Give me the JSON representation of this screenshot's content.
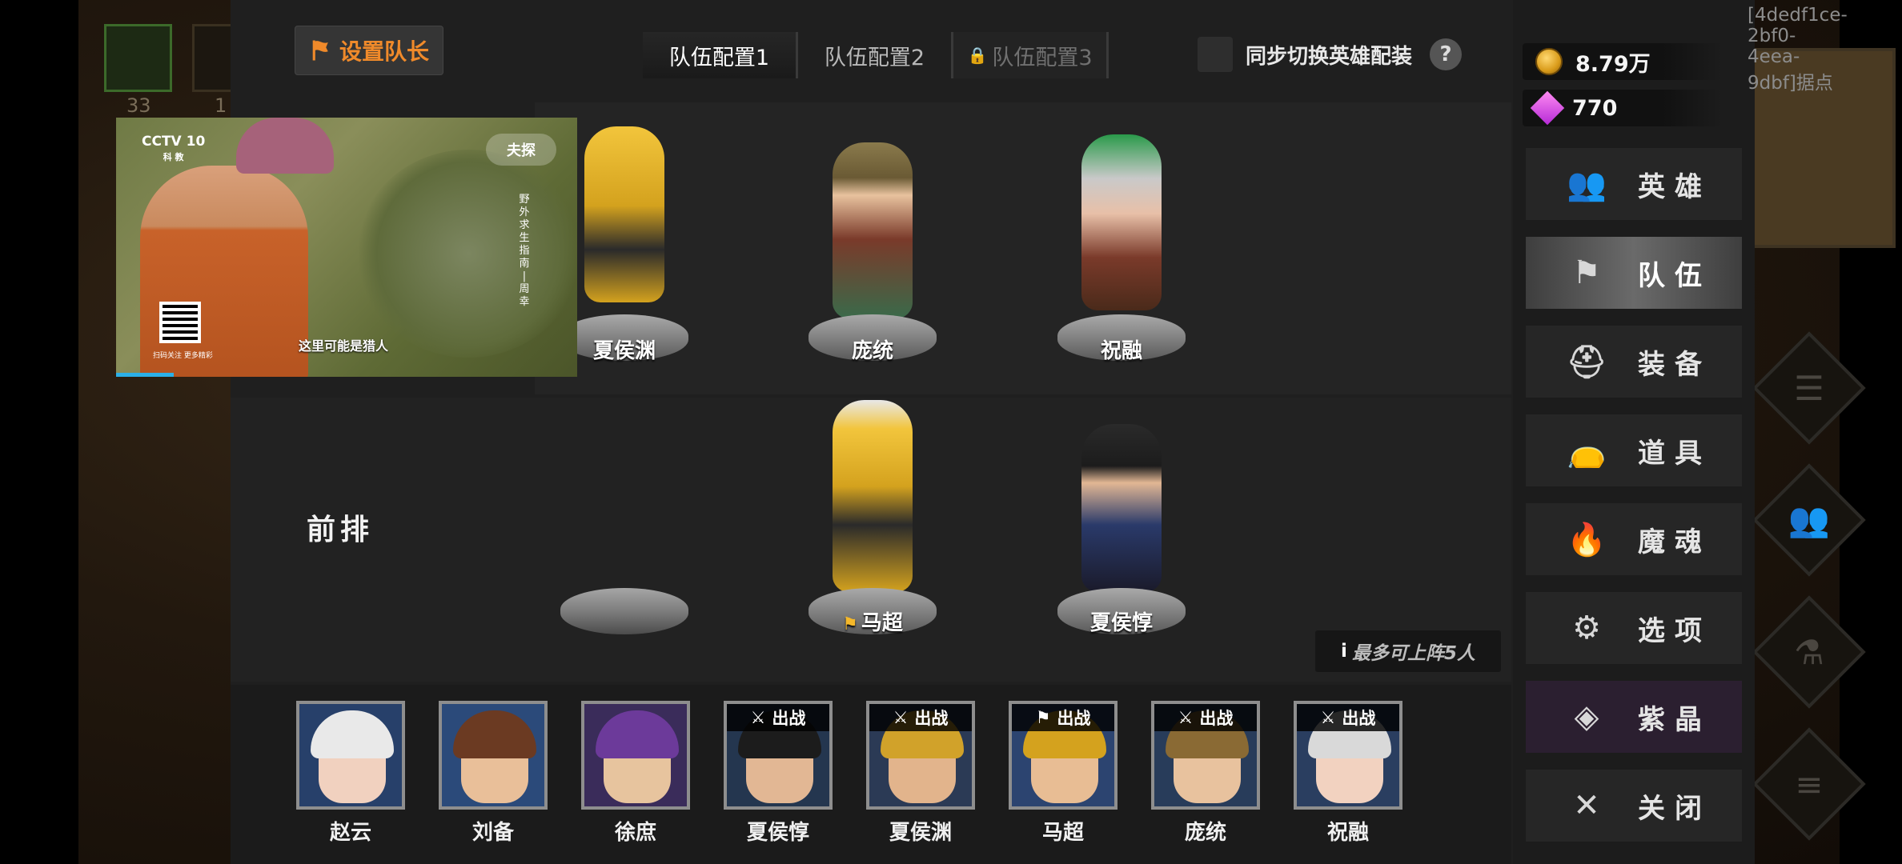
{
  "background": {
    "left_tiles_numbers": [
      "33",
      "1"
    ]
  },
  "top_bar": {
    "captain_button_label": "设置队长",
    "tabs": [
      {
        "label": "队伍配置1",
        "state": "active"
      },
      {
        "label": "队伍配置2",
        "state": "normal"
      },
      {
        "label": "队伍配置3",
        "state": "locked"
      }
    ],
    "sync_label": "同步切换英雄配装",
    "help_label": "?"
  },
  "formation": {
    "front_row_label": "前排",
    "back_row": [
      {
        "name": "夏侯渊",
        "color": "#d4a21e"
      },
      {
        "name": "庞统",
        "color": "#7a3a2a"
      },
      {
        "name": "祝融",
        "color": "#c9c9c9"
      }
    ],
    "front_row": [
      {
        "name": "",
        "empty": true
      },
      {
        "name": "马超",
        "captain": true,
        "color": "#d4a21e"
      },
      {
        "name": "夏侯惇",
        "color": "#2a2a3a"
      }
    ],
    "max_note": "最多可上阵5人",
    "max_note_icon": "i"
  },
  "roster": [
    {
      "name": "赵云",
      "badge": "",
      "face": "#f1d1bf",
      "hair": "#e9e9e9",
      "bg": "#27406a"
    },
    {
      "name": "刘备",
      "badge": "",
      "face": "#e9bf99",
      "hair": "#6b3a22",
      "bg": "#2b4a7a"
    },
    {
      "name": "徐庶",
      "badge": "",
      "face": "#e7c49e",
      "hair": "#6c3a9a",
      "bg": "#3a2c5a"
    },
    {
      "name": "夏侯惇",
      "badge": "出战",
      "badge_icon": "swords-icon",
      "face": "#e2b794",
      "hair": "#1c1c1c",
      "bg": "#24364f"
    },
    {
      "name": "夏侯渊",
      "badge": "出战",
      "badge_icon": "swords-icon",
      "face": "#e2b48c",
      "hair": "#d1a22a",
      "bg": "#2b3a55"
    },
    {
      "name": "马超",
      "badge": "出战",
      "badge_icon": "flag-icon",
      "face": "#e8bd94",
      "hair": "#d4a21e",
      "bg": "#2c4470"
    },
    {
      "name": "庞统",
      "badge": "出战",
      "badge_icon": "swords-icon",
      "face": "#e8c29e",
      "hair": "#8a6a34",
      "bg": "#283c5a"
    },
    {
      "name": "祝融",
      "badge": "出战",
      "badge_icon": "swords-icon",
      "face": "#f2d2c0",
      "hair": "#d9d9d9",
      "bg": "#2a3e60"
    }
  ],
  "right_menu": {
    "gold": "8.79万",
    "gems": "770",
    "items": [
      {
        "label": "英雄",
        "icon": "users-icon",
        "glyph": "👥"
      },
      {
        "label": "队伍",
        "icon": "flag-icon",
        "glyph": "⚑",
        "active": true
      },
      {
        "label": "装备",
        "icon": "helmet-icon",
        "glyph": "⛑"
      },
      {
        "label": "道具",
        "icon": "bag-icon",
        "glyph": "👝"
      },
      {
        "label": "魔魂",
        "icon": "flame-icon",
        "glyph": "🔥"
      },
      {
        "label": "选项",
        "icon": "gear-icon",
        "glyph": "⚙"
      },
      {
        "label": "紫晶",
        "icon": "crystal-icon",
        "glyph": "◈",
        "purple": true
      },
      {
        "label": "关闭",
        "icon": "close-icon",
        "glyph": "✕"
      }
    ]
  },
  "watermark": "[4dedf1ce-2bf0-4eea-9dbf]据点",
  "video": {
    "channel_logo": "CCTV 10",
    "channel_sub": "科 教",
    "program_brand": "夫探",
    "side_text": "野外求生指南 | 周幸",
    "qr_text": "扫码关注 更多精彩",
    "caption": "这里可能是猎人",
    "progress": 0.125
  },
  "colors": {
    "accent_orange": "#f08a2a",
    "panel_bg": "#1f1f1f",
    "menu_active": "#6a6a6a"
  }
}
